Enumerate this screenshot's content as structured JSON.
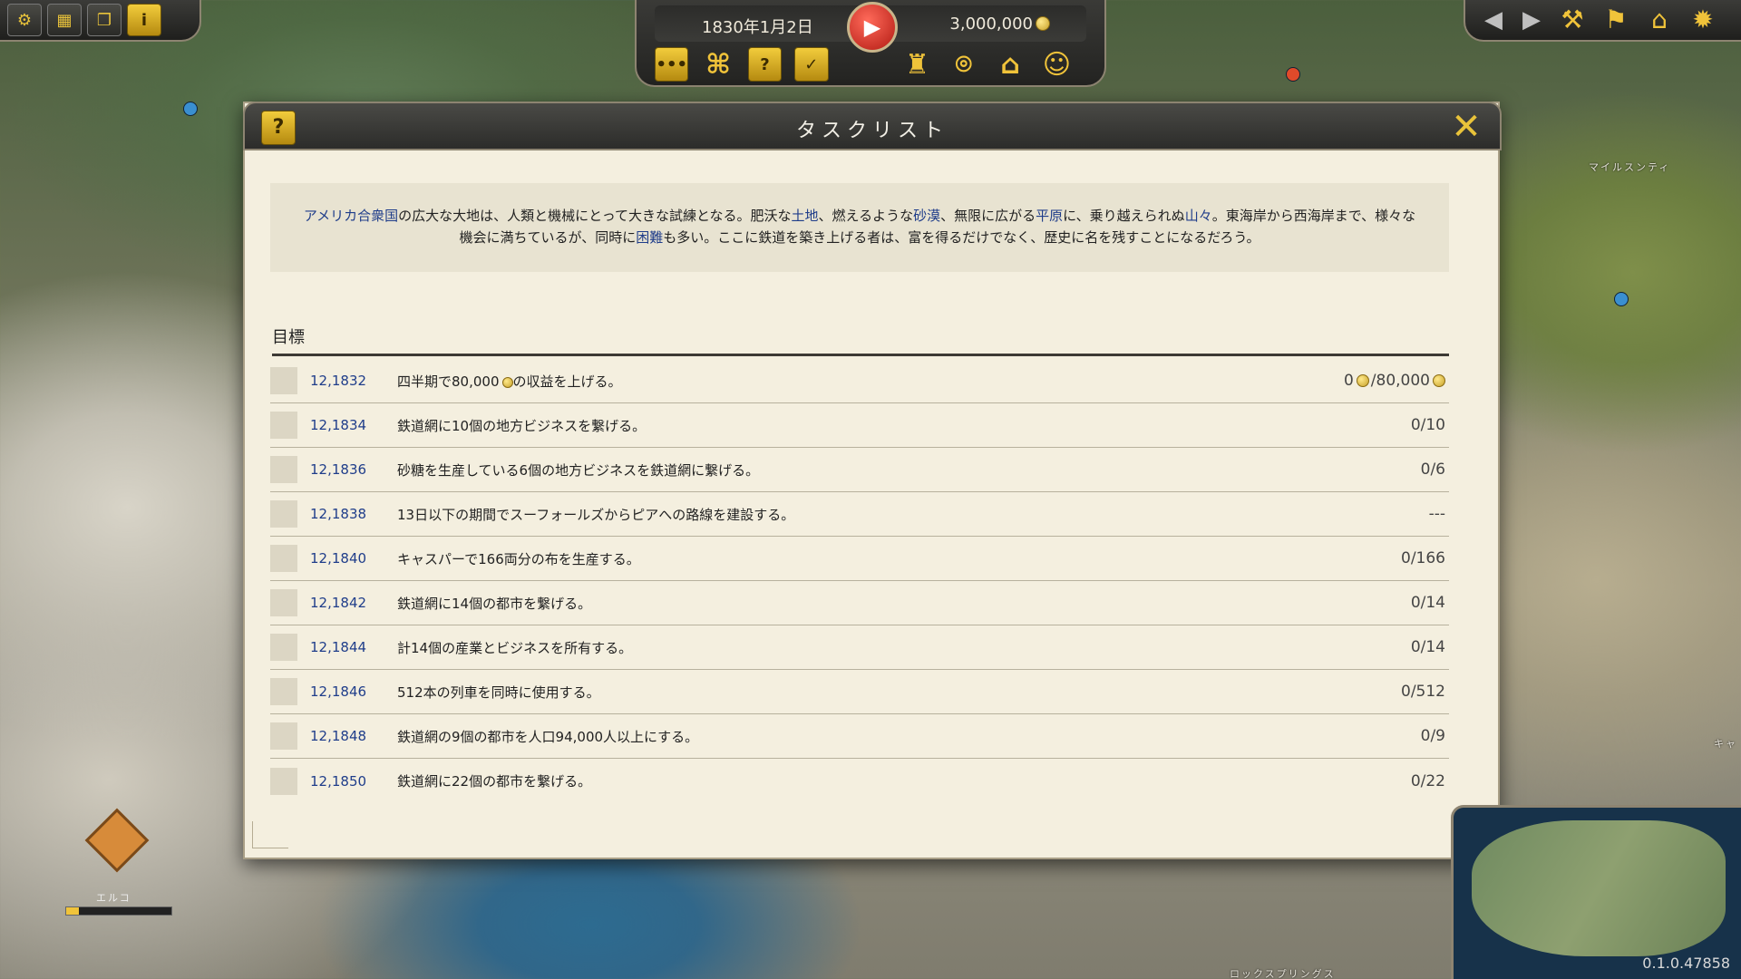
{
  "hud": {
    "date": "1830年1月2日",
    "money": "3,000,000"
  },
  "map": {
    "label_top_right": "マイルスンティ",
    "label_bottom": "ロックスプリングス",
    "label_right_edge": "キャ",
    "badge_label": "エルコ"
  },
  "dialog": {
    "title": "タスクリスト",
    "intro": {
      "p1": "アメリカ合衆国",
      "p2": "の広大な大地は、人類と機械にとって大きな試練となる。肥沃な",
      "p3": "土地",
      "p4": "、燃えるような",
      "p5": "砂漠",
      "p6": "、無限に広がる",
      "p7": "平原",
      "p8": "に、乗り越えられぬ",
      "p9": "山々",
      "p10": "。東海岸から西海岸まで、様々な機会に満ちているが、同時に",
      "p11": "困難",
      "p12": "も多い。ここに鉄道を築き上げる者は、富を得るだけでなく、歴史に名を残すことになるだろう。"
    },
    "objectives_label": "目標",
    "tasks": [
      {
        "date": "12,1832",
        "text_a": "四半期で80,000",
        "text_b": "の収益を上げる。",
        "progress_a": "0",
        "progress_b": "/80,000"
      },
      {
        "date": "12,1834",
        "text": "鉄道網に10個の地方ビジネスを繋げる。",
        "progress": "0/10"
      },
      {
        "date": "12,1836",
        "text": "砂糖を生産している6個の地方ビジネスを鉄道網に繋げる。",
        "progress": "0/6"
      },
      {
        "date": "12,1838",
        "text": "13日以下の期間でスーフォールズからピアへの路線を建設する。",
        "progress": "---"
      },
      {
        "date": "12,1840",
        "text": "キャスパーで166両分の布を生産する。",
        "progress": "0/166"
      },
      {
        "date": "12,1842",
        "text": "鉄道網に14個の都市を繋げる。",
        "progress": "0/14"
      },
      {
        "date": "12,1844",
        "text": "計14個の産業とビジネスを所有する。",
        "progress": "0/14"
      },
      {
        "date": "12,1846",
        "text": "512本の列車を同時に使用する。",
        "progress": "0/512"
      },
      {
        "date": "12,1848",
        "text": "鉄道網の9個の都市を人口94,000人以上にする。",
        "progress": "0/9"
      },
      {
        "date": "12,1850",
        "text": "鉄道網に22個の都市を繋げる。",
        "progress": "0/22"
      }
    ]
  },
  "version": "0.1.0.47858",
  "icons": {
    "topleft": [
      "gear-icon",
      "grid-icon",
      "layers-icon",
      "info-icon"
    ],
    "hud": [
      "more-icon",
      "hierarchy-icon",
      "help-icon",
      "tasks-icon",
      "tophat-icon",
      "speedometer-icon",
      "station-icon",
      "people-icon"
    ],
    "topright": [
      "back-arrow-icon",
      "forward-arrow-icon",
      "build-icon",
      "signal-icon",
      "factory-icon",
      "settings-icon"
    ]
  },
  "colors": {
    "accent_gold": "#f0c33a",
    "link_blue": "#1f3d8a",
    "parchment": "#f4efdf",
    "play_red": "#b21a12"
  }
}
